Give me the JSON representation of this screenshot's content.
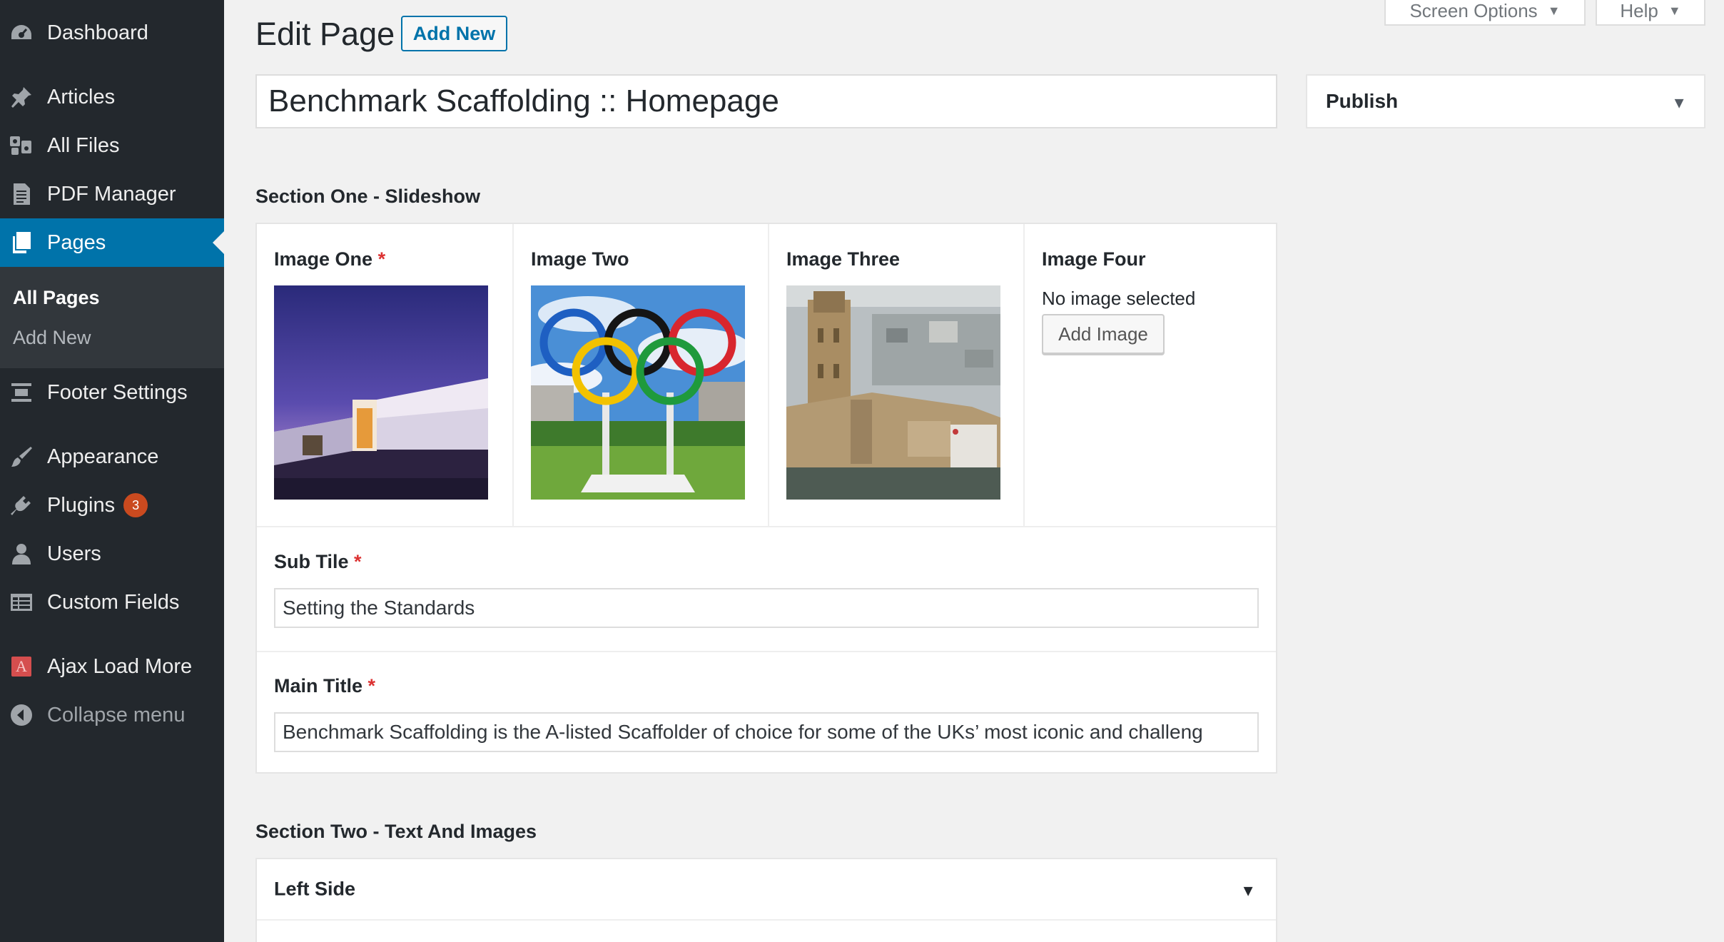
{
  "sidebar": {
    "items": [
      {
        "label": "Dashboard",
        "icon": "dashboard-icon"
      },
      {
        "label": "Articles",
        "icon": "pin-icon"
      },
      {
        "label": "All Files",
        "icon": "media-icon"
      },
      {
        "label": "PDF Manager",
        "icon": "document-icon"
      },
      {
        "label": "Pages",
        "icon": "pages-icon"
      },
      {
        "label": "Footer Settings",
        "icon": "footer-settings-icon"
      },
      {
        "label": "Appearance",
        "icon": "paintbrush-icon"
      },
      {
        "label": "Plugins",
        "icon": "plugin-icon",
        "badge": "3"
      },
      {
        "label": "Users",
        "icon": "user-icon"
      },
      {
        "label": "Custom Fields",
        "icon": "custom-fields-icon"
      },
      {
        "label": "Ajax Load More",
        "icon": "ajax-load-more-icon",
        "icon_letter": "A"
      },
      {
        "label": "Collapse menu",
        "icon": "collapse-icon"
      }
    ],
    "submenu": [
      {
        "label": "All Pages"
      },
      {
        "label": "Add New"
      }
    ]
  },
  "topbar": {
    "screen_options": "Screen Options",
    "help": "Help"
  },
  "heading": {
    "title": "Edit Page",
    "add_new": "Add New"
  },
  "post": {
    "title": "Benchmark Scaffolding :: Homepage"
  },
  "publish": {
    "title": "Publish"
  },
  "section_one": {
    "heading": "Section One - Slideshow",
    "images": [
      {
        "label": "Image One",
        "required": "*"
      },
      {
        "label": "Image Two"
      },
      {
        "label": "Image Three"
      },
      {
        "label": "Image Four",
        "empty_text": "No image selected",
        "button": "Add Image"
      }
    ],
    "sub_title": {
      "label": "Sub Tile",
      "required": "*",
      "value": "Setting the Standards"
    },
    "main_title": {
      "label": "Main Title",
      "required": "*",
      "value": "Benchmark Scaffolding is the A-listed Scaffolder of choice for some of the UKs’ most iconic and challeng"
    }
  },
  "section_two": {
    "heading": "Section Two - Text And Images",
    "left_side": "Left Side"
  },
  "colors": {
    "sidebar_bg": "#23282d",
    "accent": "#0073aa",
    "badge": "#ca4a1f",
    "required": "#dc3232"
  }
}
